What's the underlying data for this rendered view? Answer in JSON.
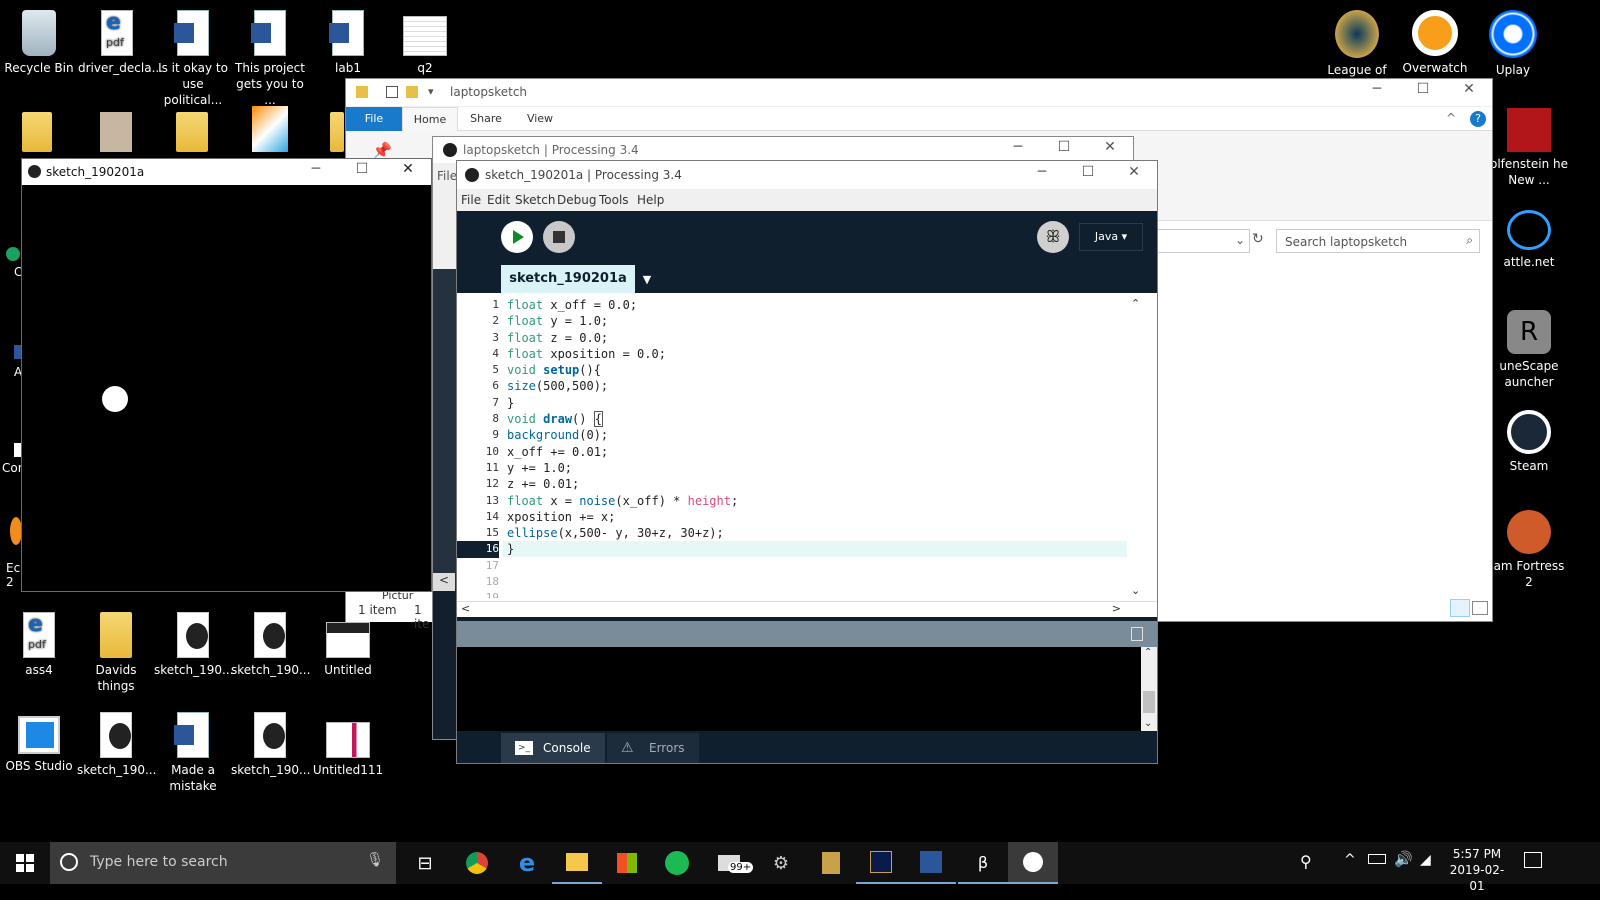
{
  "desktop": {
    "left_icons": [
      {
        "label": "Recycle Bin",
        "icon": "recycle-bin-icon"
      },
      {
        "label": "driver_decla...",
        "icon": "pdf-icon"
      },
      {
        "label": "Is it okay to use political...",
        "icon": "word-doc-icon"
      },
      {
        "label": "This project gets you to ...",
        "icon": "word-doc-icon"
      },
      {
        "label": "lab1",
        "icon": "word-doc-icon"
      },
      {
        "label": "q2",
        "icon": "image-icon"
      }
    ],
    "bottom_icons_row1": [
      {
        "label": "ass4",
        "icon": "pdf-icon"
      },
      {
        "label": "Davids things",
        "icon": "folder-icon"
      },
      {
        "label": "sketch_190...",
        "icon": "processing-file-icon"
      },
      {
        "label": "sketch_190...",
        "icon": "processing-file-icon"
      },
      {
        "label": "Untitled",
        "icon": "image-icon"
      }
    ],
    "bottom_icons_row2": [
      {
        "label": "OBS Studio",
        "icon": "obs-icon"
      },
      {
        "label": "sketch_190...",
        "icon": "processing-file-icon"
      },
      {
        "label": "Made a mistake",
        "icon": "word-doc-icon"
      },
      {
        "label": "sketch_190...",
        "icon": "processing-file-icon"
      },
      {
        "label": "Untitled111",
        "icon": "image-icon"
      }
    ],
    "right_icons": [
      {
        "label": "League of",
        "icon": "league-icon"
      },
      {
        "label": "Overwatch",
        "icon": "overwatch-icon"
      },
      {
        "label": "Uplay",
        "icon": "uplay-icon"
      }
    ],
    "right_column": [
      {
        "label": "olfenstein he New ...",
        "icon": "wolfenstein-icon"
      },
      {
        "label": "attle.net",
        "icon": "battlenet-icon"
      },
      {
        "label": "uneScape auncher",
        "icon": "runescape-icon"
      },
      {
        "label": "Steam",
        "icon": "steam-icon"
      },
      {
        "label": "am Fortress 2",
        "icon": "tf2-icon"
      }
    ],
    "partial_left_labels": [
      "C",
      "A",
      "Cor",
      "Ecl 2"
    ]
  },
  "explorer": {
    "title": "laptopsketch",
    "ribbon_tabs": [
      "File",
      "Home",
      "Share",
      "View"
    ],
    "search_placeholder": "Search laptopsketch",
    "status_items": "1 item",
    "status_items2": "1 ite",
    "pictures_label": "Pictur"
  },
  "processing_back": {
    "title": "laptopsketch | Processing 3.4",
    "menu_first": "File"
  },
  "sketch_window": {
    "title": "sketch_190201a"
  },
  "processing": {
    "title": "sketch_190201a | Processing 3.4",
    "menu": [
      "File",
      "Edit",
      "Sketch",
      "Debug",
      "Tools",
      "Help"
    ],
    "mode": "Java ▾",
    "tab": "sketch_190201a",
    "line_numbers": [
      "1",
      "2",
      "3",
      "4",
      "5",
      "6",
      "7",
      "8",
      "9",
      "10",
      "11",
      "12",
      "13",
      "14",
      "15",
      "16",
      "17",
      "18",
      "19"
    ],
    "console_tab": "Console",
    "errors_tab": "Errors"
  },
  "taskbar": {
    "search_placeholder": "Type here to search",
    "time": "5:57 PM",
    "date": "2019-02-01",
    "mail_badge": "99+"
  },
  "colors": {
    "processing_bg": "#0f1f2e",
    "processing_accent": "#d9f3f7",
    "explorer_file_tab": "#1979ca"
  }
}
